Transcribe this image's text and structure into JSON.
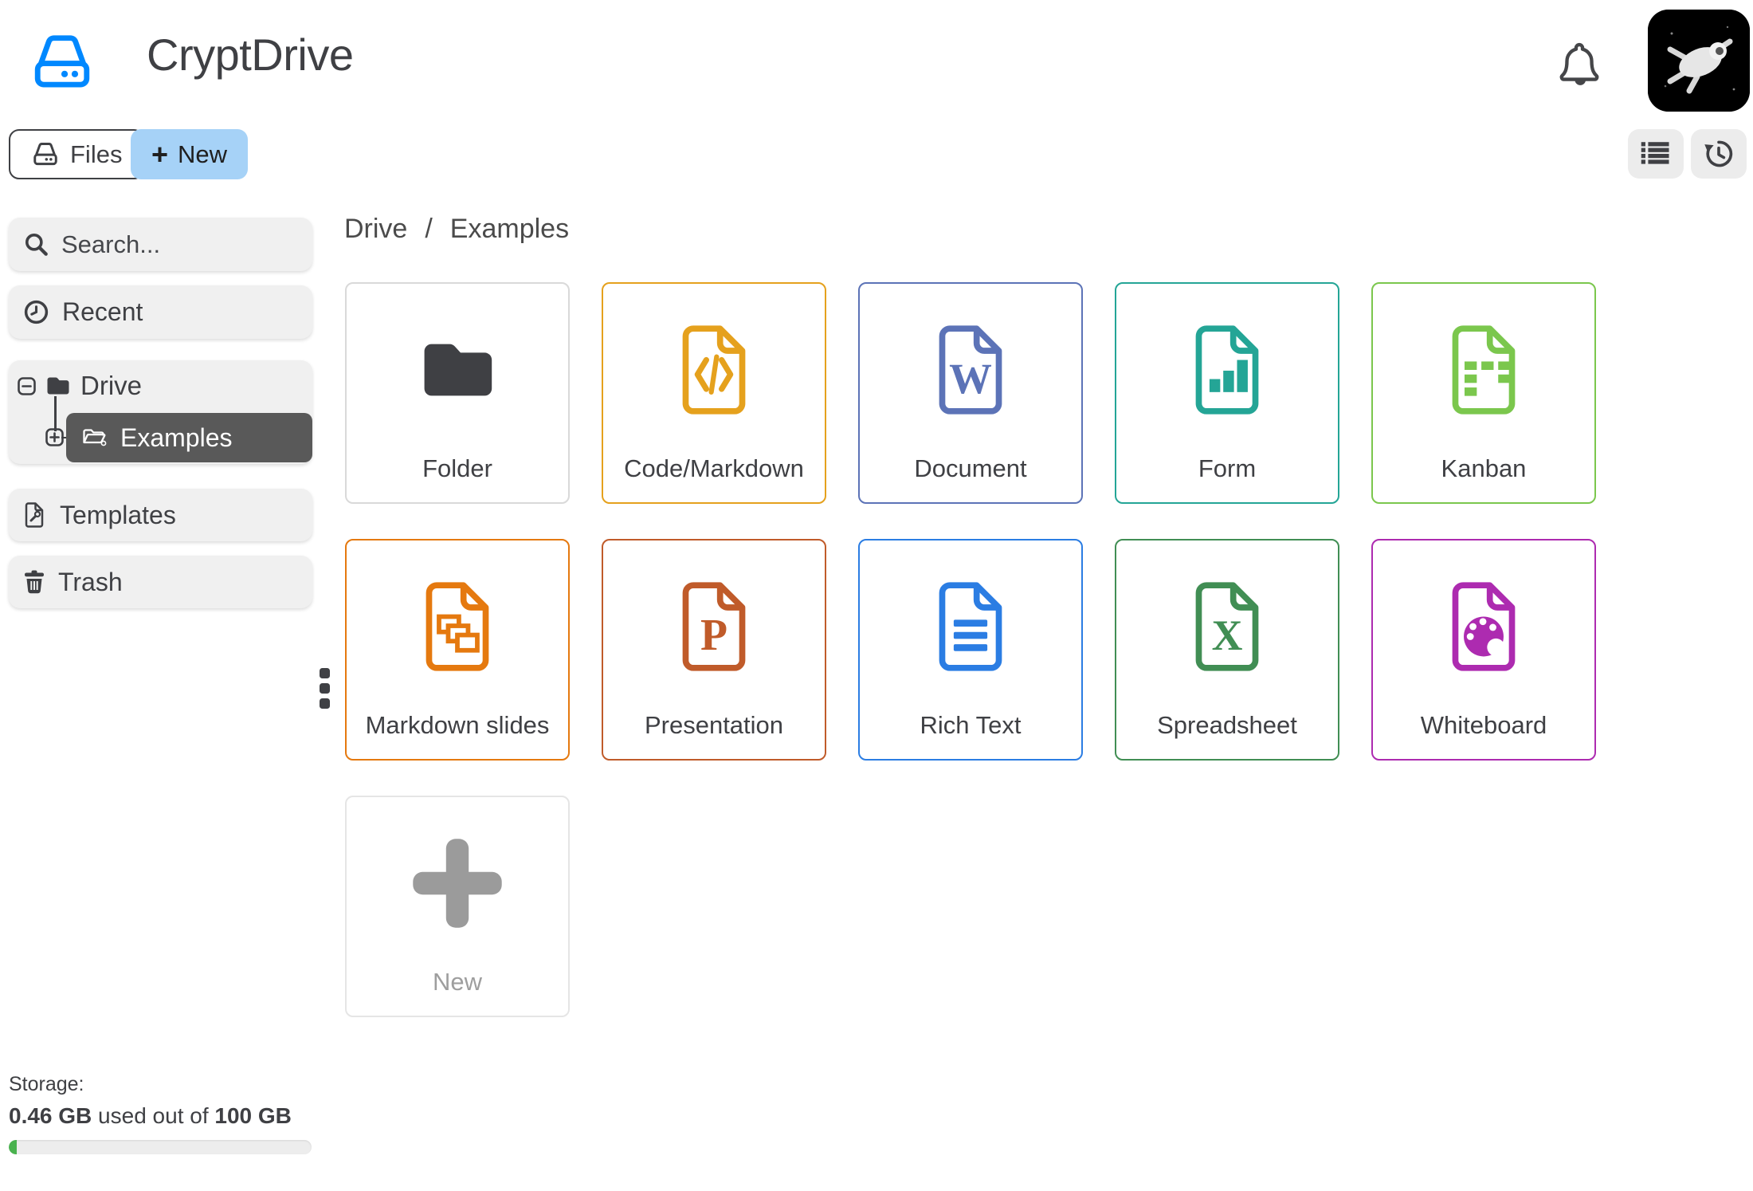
{
  "header": {
    "title": "CryptDrive"
  },
  "toolbar": {
    "files_label": "Files",
    "new_plus": "+",
    "new_label": "New"
  },
  "breadcrumb": {
    "root": "Drive",
    "separator": "/",
    "current": "Examples"
  },
  "sidebar": {
    "search_placeholder": "Search...",
    "recent_label": "Recent",
    "drive_label": "Drive",
    "examples_label": "Examples",
    "templates_label": "Templates",
    "trash_label": "Trash",
    "storage": {
      "label": "Storage:",
      "used": "0.46 GB",
      "infix": " used out of ",
      "total": "100 GB",
      "percent_used": 0.46
    }
  },
  "main": {
    "cards": [
      {
        "id": "folder",
        "label": "Folder",
        "icon": "folder",
        "color": "#3f4044",
        "border": "#d9d9d9"
      },
      {
        "id": "code",
        "label": "Code/Markdown",
        "icon": "code",
        "color": "#e5a11d",
        "border": "#e5a11d"
      },
      {
        "id": "document",
        "label": "Document",
        "icon": "doc-w",
        "color": "#5c73b7",
        "border": "#5c73b7"
      },
      {
        "id": "form",
        "label": "Form",
        "icon": "form",
        "color": "#24a596",
        "border": "#24a596"
      },
      {
        "id": "kanban",
        "label": "Kanban",
        "icon": "kanban",
        "color": "#7bc74d",
        "border": "#7bc74d"
      },
      {
        "id": "slides",
        "label": "Markdown slides",
        "icon": "slides",
        "color": "#e5790f",
        "border": "#e5790f"
      },
      {
        "id": "presentation",
        "label": "Presentation",
        "icon": "pres-p",
        "color": "#c05b2a",
        "border": "#c05b2a"
      },
      {
        "id": "richtext",
        "label": "Rich Text",
        "icon": "richtext",
        "color": "#2b7de3",
        "border": "#2b7de3"
      },
      {
        "id": "spreadsheet",
        "label": "Spreadsheet",
        "icon": "sheet-x",
        "color": "#418e54",
        "border": "#418e54"
      },
      {
        "id": "whiteboard",
        "label": "Whiteboard",
        "icon": "palette",
        "color": "#ad2bb0",
        "border": "#ad2bb0"
      },
      {
        "id": "new",
        "label": "New",
        "icon": "plus",
        "color": "#9b9b9b",
        "border": "#e5e5e5",
        "muted": true
      }
    ]
  },
  "icons": {
    "logo": "drive-icon",
    "notifications": "bell-icon",
    "view": "list-view-icon",
    "history": "history-icon",
    "search": "search-icon",
    "recent": "clock-icon",
    "drive": "folder-icon",
    "examples": "open-folder-icon",
    "templates": "template-file-icon",
    "trash": "trash-icon"
  },
  "colors": {
    "accent_blue": "#0088ff",
    "new_button_bg": "#a6d2f7",
    "selected_item_bg": "#595959",
    "sidebar_item_bg": "#f0f0f0",
    "text_dark": "#3f4044",
    "storage_fill": "#49b24e",
    "muted_gray": "#9b9b9b"
  }
}
